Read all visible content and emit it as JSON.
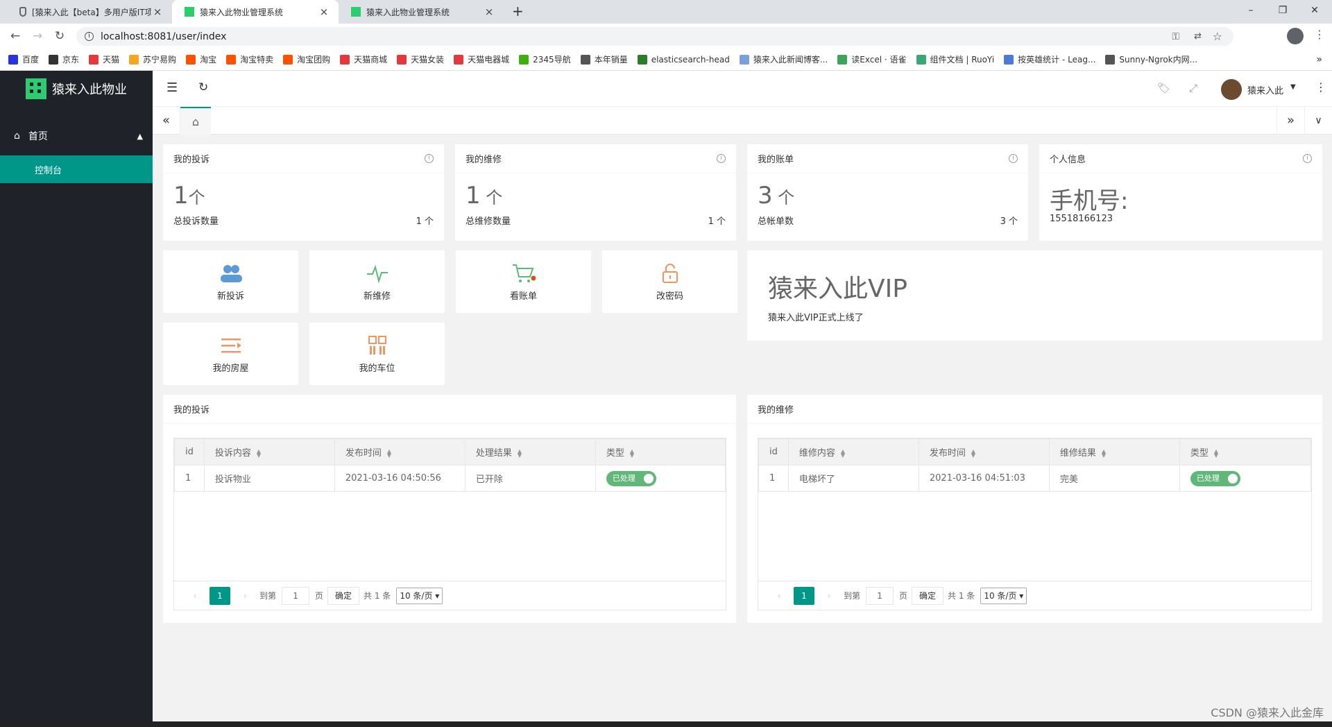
{
  "browser": {
    "tabs": [
      {
        "title": "[猿来入此【beta】多用户版IT项",
        "active": false
      },
      {
        "title": "猿来入此物业管理系统",
        "active": true
      },
      {
        "title": "猿来入此物业管理系统",
        "active": false
      }
    ],
    "url": "localhost:8081/user/index",
    "bookmarks": [
      "百度",
      "京东",
      "天猫",
      "苏宁易购",
      "淘宝",
      "淘宝特卖",
      "淘宝团购",
      "天猫商城",
      "天猫女装",
      "天猫电器城",
      "2345导航",
      "本年销量",
      "elasticsearch-head",
      "猿来入此新闻博客...",
      "读Excel · 语雀",
      "组件文档 | RuoYi",
      "按英雄统计 - Leag...",
      "Sunny-Ngrok内网..."
    ]
  },
  "sidebar": {
    "logo": "猿来入此物业",
    "menu": "首页",
    "submenu": "控制台"
  },
  "header": {
    "user": "猿来入此"
  },
  "stats": [
    {
      "title": "我的投诉",
      "value": "1",
      "unit": "个",
      "label": "总投诉数量",
      "right": "1 个"
    },
    {
      "title": "我的维修",
      "value": "1",
      "unit": " 个",
      "label": "总维修数量",
      "right": "1 个"
    },
    {
      "title": "我的账单",
      "value": "3",
      "unit": " 个",
      "label": "总帐单数",
      "right": "3 个"
    },
    {
      "title": "个人信息",
      "value": "手机号:",
      "unit": "",
      "label": "15518166123",
      "right": ""
    }
  ],
  "shortcuts": [
    "新投诉",
    "新维修",
    "看账单",
    "改密码",
    "我的房屋",
    "我的车位"
  ],
  "vip": {
    "title": "猿来入此VIP",
    "text": "猿来入此VIP正式上线了"
  },
  "complaints": {
    "title": "我的投诉",
    "columns": [
      "id",
      "投诉内容",
      "发布时间",
      "处理结果",
      "类型"
    ],
    "rows": [
      [
        "1",
        "投诉物业",
        "2021-03-16 04:50:56",
        "已开除",
        "已处理"
      ]
    ]
  },
  "repairs": {
    "title": "我的维修",
    "columns": [
      "id",
      "维修内容",
      "发布时间",
      "维修结果",
      "类型"
    ],
    "rows": [
      [
        "1",
        "电梯坏了",
        "2021-03-16 04:51:03",
        "完美",
        "已处理"
      ]
    ]
  },
  "pager": {
    "page": "1",
    "goto": "到第",
    "page_unit": "页",
    "confirm": "确定",
    "total": "共 1 条",
    "size": "10 条/页"
  },
  "watermark": "CSDN @猿来入此金库",
  "colors": {
    "accent": "#009688",
    "sidebar": "#20222a",
    "switch": "#5fb878"
  }
}
